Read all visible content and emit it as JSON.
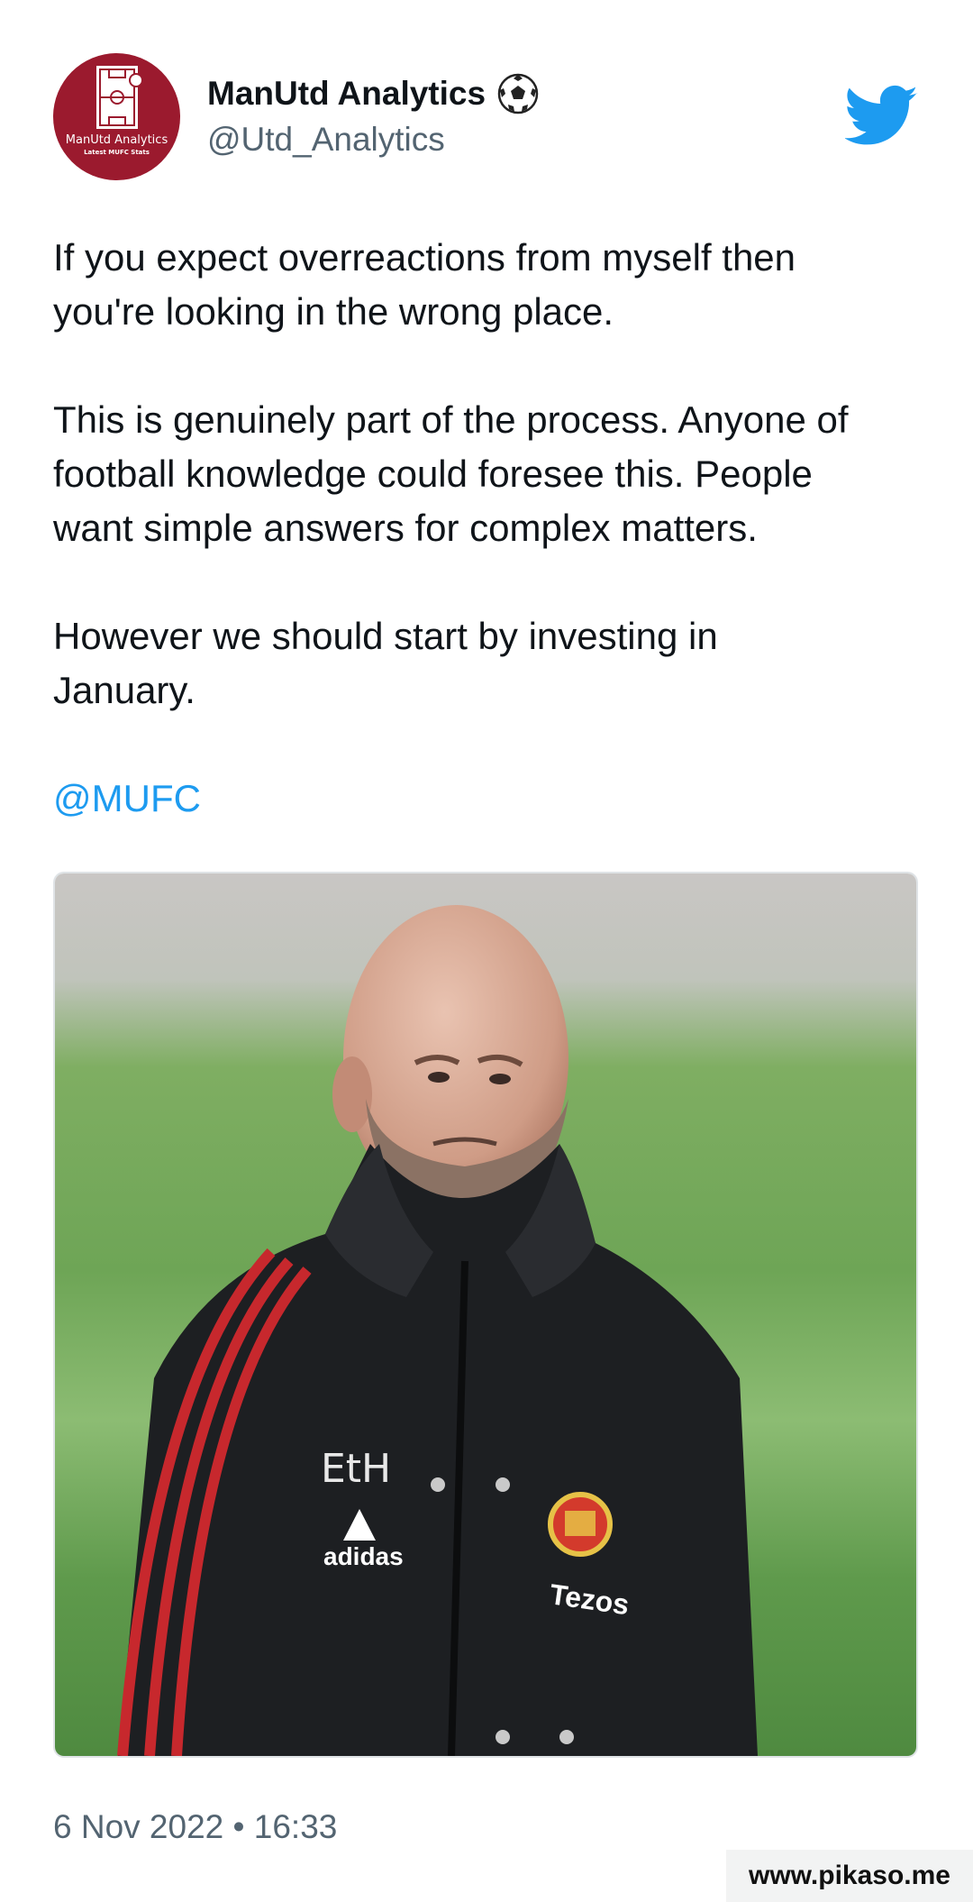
{
  "author": {
    "display_name": "ManUtd Analytics",
    "handle": "@Utd_Analytics",
    "avatar_brand": "ManUtd Analytics",
    "avatar_subtext": "Latest MUFC Stats",
    "name_emoji_icon": "soccer-ball-icon"
  },
  "platform_icon": "twitter-bird-icon",
  "accent_color": "#1d9bf0",
  "tweet": {
    "paragraphs": [
      "If you expect overreactions from myself then\nyou're looking in the wrong place.",
      "This is genuinely part of the process. Anyone of\nfootball knowledge could foresee this. People\nwant simple answers for complex matters.",
      "However we should start by investing in\nJanuary."
    ],
    "mention": "@MUFC"
  },
  "media": {
    "jacket_initials": "EtH",
    "jacket_brand": "adidas",
    "jacket_sponsor": "Tezos"
  },
  "timestamp": "6 Nov 2022 • 16:33",
  "watermark": "www.pikaso.me"
}
